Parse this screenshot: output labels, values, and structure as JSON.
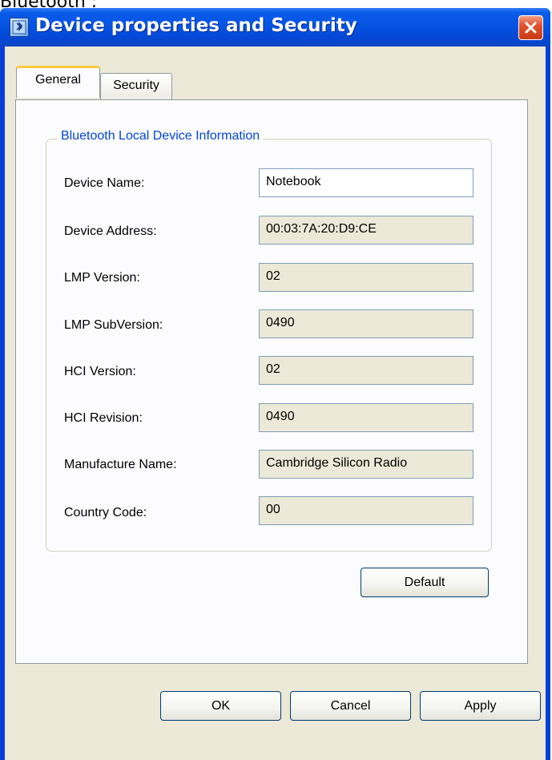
{
  "page_caption": "Bluetooth  :",
  "window": {
    "title": "Device properties and Security",
    "title_icon": "bluetooth-app-icon",
    "close_icon": "close-icon"
  },
  "tabs": [
    {
      "label": "General",
      "selected": true
    },
    {
      "label": "Security",
      "selected": false
    }
  ],
  "group": {
    "title": "Bluetooth Local Device Information"
  },
  "fields": [
    {
      "label": "Device Name:",
      "value": "Notebook",
      "editable": true
    },
    {
      "label": "Device Address:",
      "value": "00:03:7A:20:D9:CE",
      "editable": false
    },
    {
      "label": "LMP Version:",
      "value": "02",
      "editable": false
    },
    {
      "label": "LMP SubVersion:",
      "value": "0490",
      "editable": false
    },
    {
      "label": "HCI Version:",
      "value": "02",
      "editable": false
    },
    {
      "label": "HCI Revision:",
      "value": "0490",
      "editable": false
    },
    {
      "label": "Manufacture Name:",
      "value": "Cambridge Silicon Radio",
      "editable": false
    },
    {
      "label": "Country Code:",
      "value": "00",
      "editable": false
    }
  ],
  "buttons": {
    "default": "Default",
    "ok": "OK",
    "cancel": "Cancel",
    "apply": "Apply"
  },
  "colors": {
    "titlebar": "#0754e3",
    "group_title": "#0046d5",
    "close_button": "#e2522e",
    "dialog_background": "#ece9d8"
  }
}
